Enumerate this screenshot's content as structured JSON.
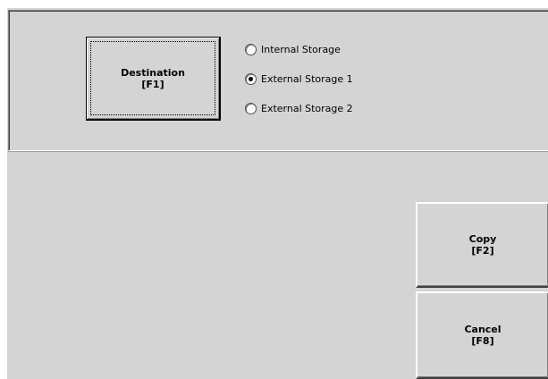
{
  "destination_button": {
    "line1": "Destination",
    "line2": "[F1]"
  },
  "storage_options": [
    {
      "label": "Internal Storage",
      "selected": false
    },
    {
      "label": "External Storage 1",
      "selected": true
    },
    {
      "label": "External Storage 2",
      "selected": false
    }
  ],
  "copy_button": {
    "line1": "Copy",
    "line2": "[F2]"
  },
  "cancel_button": {
    "line1": "Cancel",
    "line2": "[F8]"
  },
  "colors": {
    "background": "#d4d4d4",
    "radio_fill": "#ffffff"
  }
}
